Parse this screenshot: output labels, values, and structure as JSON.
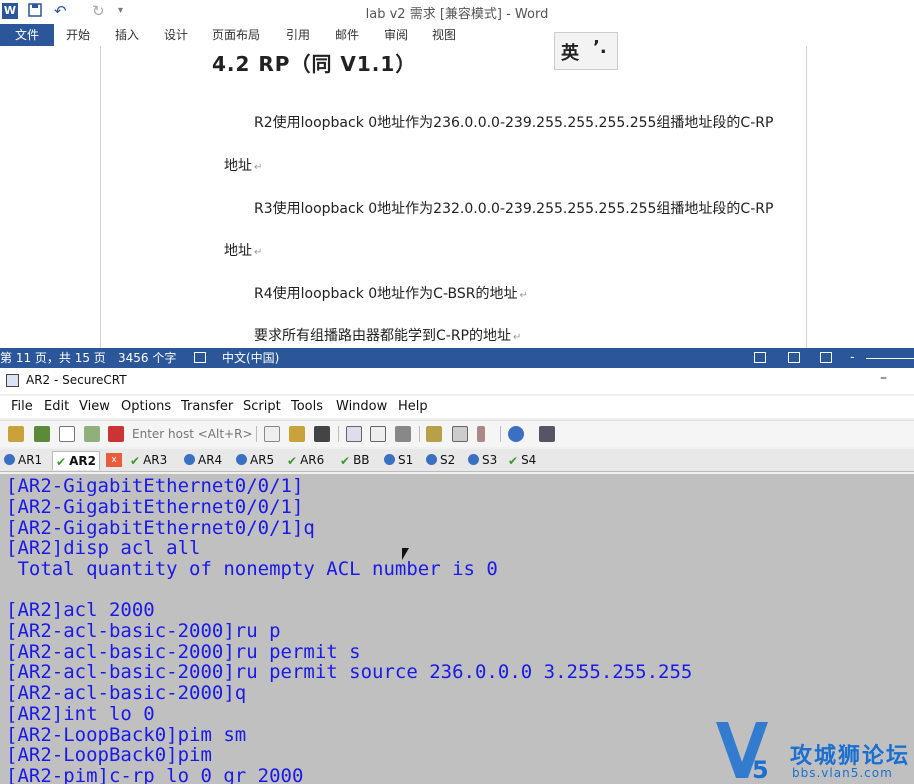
{
  "word": {
    "title": "lab v2 需求 [兼容模式] - Word",
    "quick_access": {
      "undo": "↶",
      "redo": "↻"
    },
    "ribbon_tabs": [
      "文件",
      "开始",
      "插入",
      "设计",
      "页面布局",
      "引用",
      "邮件",
      "审阅",
      "视图"
    ],
    "heading": "4.2 RP（同 V1.1）",
    "paragraphs": [
      "R2使用loopback 0地址作为236.0.0.0-239.255.255.255.255组播地址段的C-RP",
      "地址",
      "R3使用loopback 0地址作为232.0.0.0-239.255.255.255.255组播地址段的C-RP",
      "地址",
      "R4使用loopback 0地址作为C-BSR的地址",
      "要求所有组播路由器都能学到C-RP的地址"
    ],
    "ime": {
      "lang": "英",
      "punct": "’."
    },
    "status": {
      "page": "第 11 页，共 15 页",
      "words": "3456 个字",
      "lang": "中文(中国)",
      "zoom_minus": "-"
    }
  },
  "crt": {
    "title": "AR2 - SecureCRT",
    "minimize": "–",
    "menu": [
      "File",
      "Edit",
      "View",
      "Options",
      "Transfer",
      "Script",
      "Tools",
      "Window",
      "Help"
    ],
    "quick_connect_placeholder": "Enter host <Alt+R>",
    "session_tabs": [
      {
        "label": "AR1",
        "status": "info"
      },
      {
        "label": "AR2",
        "status": "ok",
        "active": true
      },
      {
        "label": "AR3",
        "status": "ok"
      },
      {
        "label": "AR4",
        "status": "info"
      },
      {
        "label": "AR5",
        "status": "info"
      },
      {
        "label": "AR6",
        "status": "ok"
      },
      {
        "label": "BB",
        "status": "ok"
      },
      {
        "label": "S1",
        "status": "info"
      },
      {
        "label": "S2",
        "status": "info"
      },
      {
        "label": "S3",
        "status": "info"
      },
      {
        "label": "S4",
        "status": "ok"
      }
    ],
    "close_tab": "x",
    "terminal_lines": [
      "[AR2-GigabitEthernet0/0/1]",
      "[AR2-GigabitEthernet0/0/1]",
      "[AR2-GigabitEthernet0/0/1]q",
      "[AR2]disp acl all",
      " Total quantity of nonempty ACL number is 0",
      "",
      "[AR2]acl 2000",
      "[AR2-acl-basic-2000]ru p",
      "[AR2-acl-basic-2000]ru permit s",
      "[AR2-acl-basic-2000]ru permit source 236.0.0.0 3.255.255.255",
      "[AR2-acl-basic-2000]q",
      "[AR2]int lo 0",
      "[AR2-LoopBack0]pim sm",
      "[AR2-LoopBack0]pim",
      "[AR2-pim]c-rp lo 0 gr 2000"
    ]
  },
  "watermark": {
    "text": "攻城狮论坛",
    "url": "bbs.vlan5.com"
  }
}
